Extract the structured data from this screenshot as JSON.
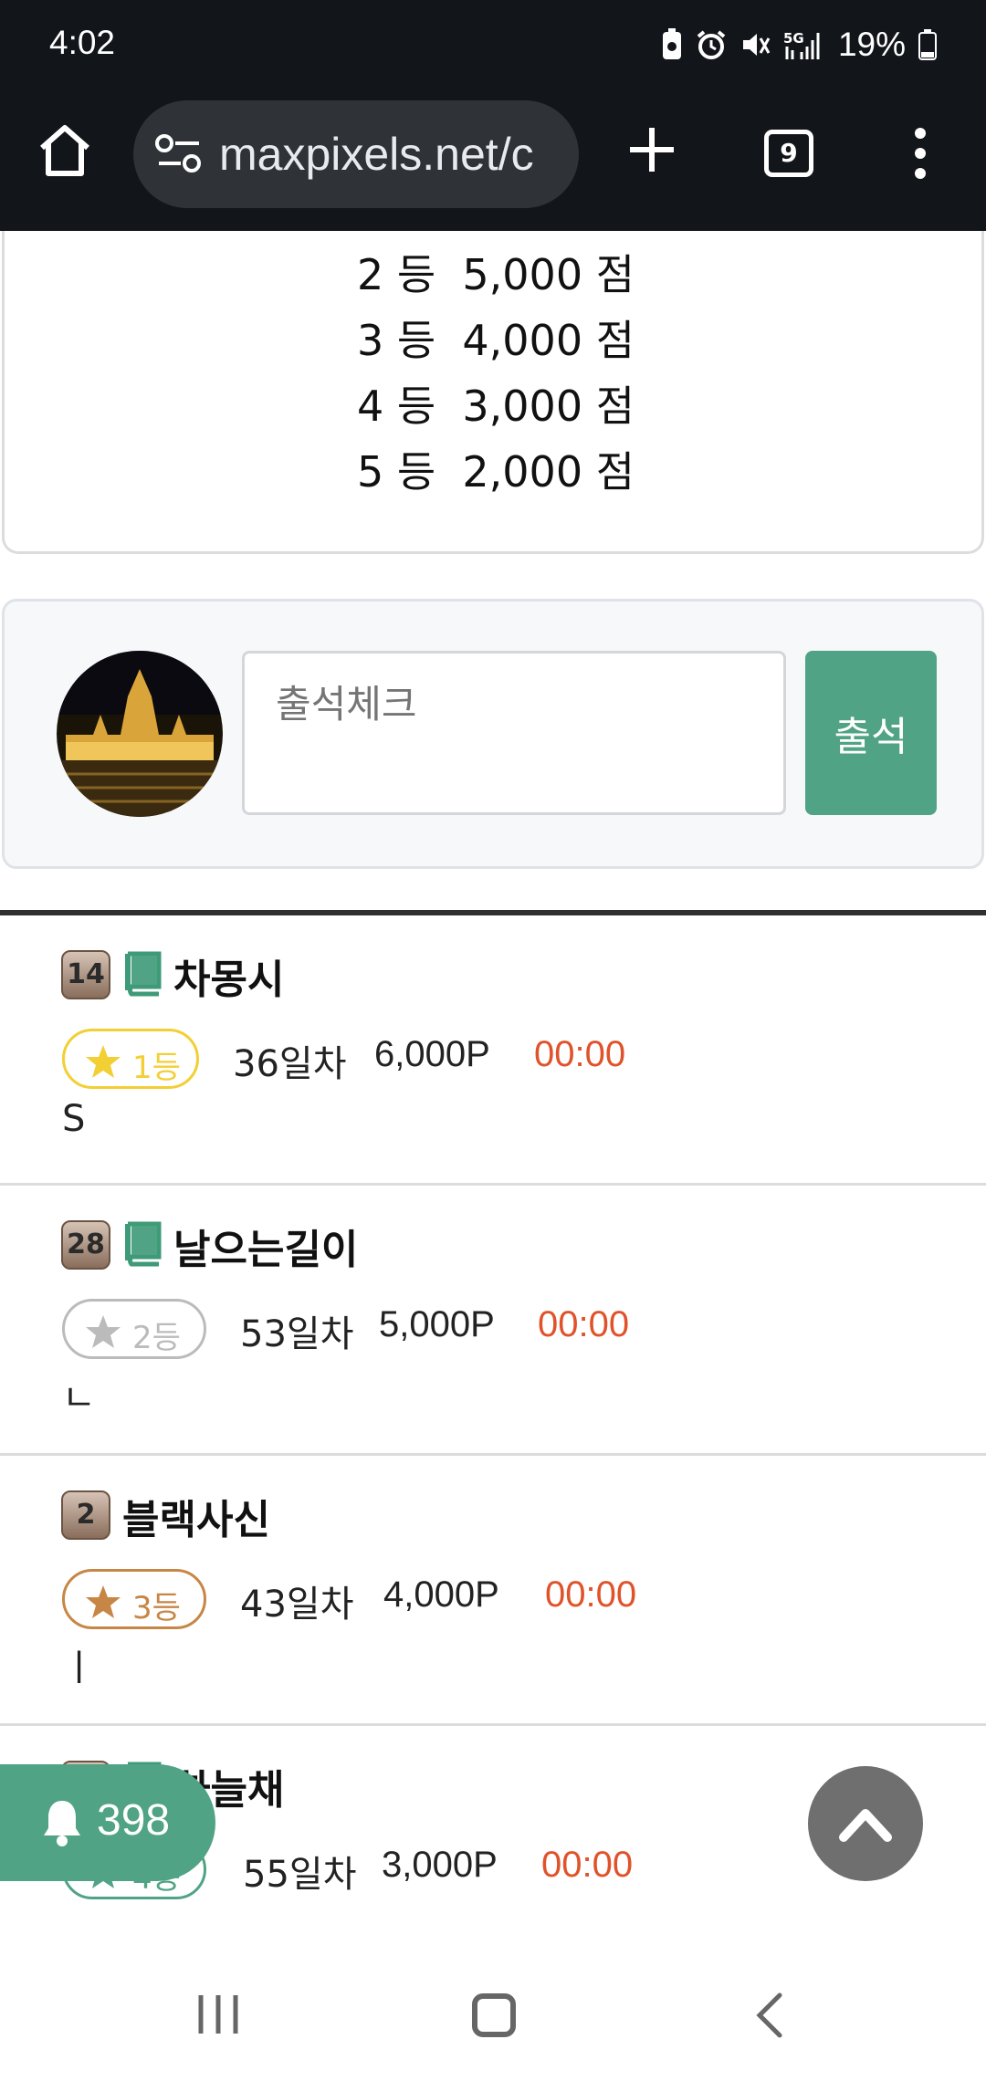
{
  "status_bar": {
    "time": "4:02",
    "battery": "19%",
    "network": "5G"
  },
  "browser": {
    "url": "maxpixels.net/c",
    "tab_count": "9"
  },
  "ranking": {
    "lines": [
      {
        "rank": "2 등",
        "score": "5,000 점"
      },
      {
        "rank": "3 등",
        "score": "4,000 점"
      },
      {
        "rank": "4 등",
        "score": "3,000 점"
      },
      {
        "rank": "5 등",
        "score": "2,000 점"
      }
    ]
  },
  "attendance": {
    "placeholder": "출석체크",
    "button_label": "출석"
  },
  "entries": [
    {
      "level": "14",
      "has_book": true,
      "nickname": "차몽시",
      "rank_label": "1등",
      "rank_color": "#f2cf34",
      "days": "36일차",
      "points": "6,000P",
      "time": "00:00",
      "comment": "S"
    },
    {
      "level": "28",
      "has_book": true,
      "nickname": "날으는길이",
      "rank_label": "2등",
      "rank_color": "#bbbbbb",
      "days": "53일차",
      "points": "5,000P",
      "time": "00:00",
      "comment": "ㄴ"
    },
    {
      "level": "2",
      "has_book": false,
      "nickname": "블랙사신",
      "rank_label": "3등",
      "rank_color": "#c78645",
      "days": "43일차",
      "points": "4,000P",
      "time": "00:00",
      "comment": "ㅣ"
    },
    {
      "level": "",
      "has_book": true,
      "nickname": "하늘채",
      "rank_label": "4등",
      "rank_color": "#50a385",
      "days": "55일차",
      "points": "3,000P",
      "time": "00:00",
      "comment": ""
    }
  ],
  "notifications": {
    "count": "398"
  },
  "colors": {
    "accent": "#50a385",
    "time_red": "#e0532a",
    "dark_bar": "#12161b"
  }
}
